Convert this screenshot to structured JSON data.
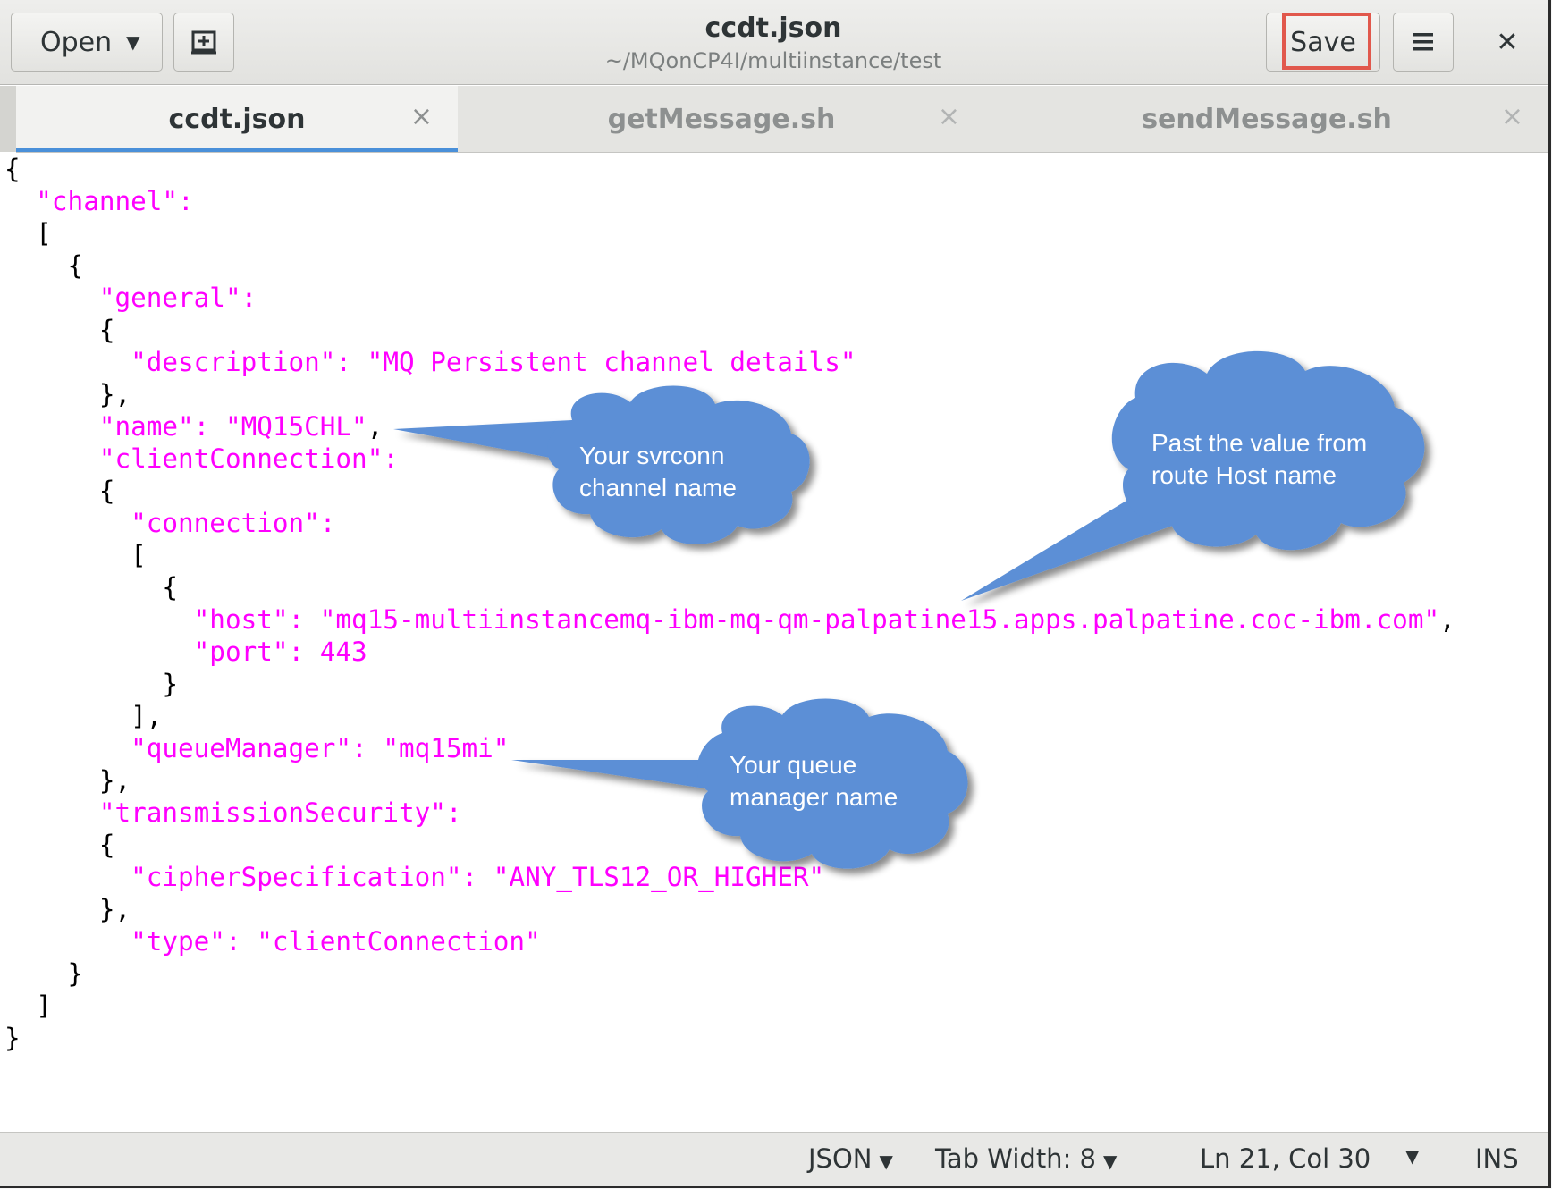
{
  "header": {
    "open_label": "Open",
    "title": "ccdt.json",
    "subtitle": "~/MQonCP4I/multiinstance/test",
    "save_label": "Save"
  },
  "tabs": [
    {
      "label": "ccdt.json",
      "active": true
    },
    {
      "label": "getMessage.sh",
      "active": false
    },
    {
      "label": "sendMessage.sh",
      "active": false
    }
  ],
  "code_lines": [
    [
      {
        "t": "{",
        "c": "p"
      }
    ],
    [
      {
        "t": "  ",
        "c": "p"
      },
      {
        "t": "\"channel\":",
        "c": "s"
      }
    ],
    [
      {
        "t": "  [",
        "c": "p"
      }
    ],
    [
      {
        "t": "    {",
        "c": "p"
      }
    ],
    [
      {
        "t": "      ",
        "c": "p"
      },
      {
        "t": "\"general\":",
        "c": "s"
      }
    ],
    [
      {
        "t": "      {",
        "c": "p"
      }
    ],
    [
      {
        "t": "        ",
        "c": "p"
      },
      {
        "t": "\"description\": \"MQ Persistent channel details\"",
        "c": "s"
      }
    ],
    [
      {
        "t": "      },",
        "c": "p"
      }
    ],
    [
      {
        "t": "      ",
        "c": "p"
      },
      {
        "t": "\"name\": \"MQ15CHL\"",
        "c": "s"
      },
      {
        "t": ",",
        "c": "p"
      }
    ],
    [
      {
        "t": "      ",
        "c": "p"
      },
      {
        "t": "\"clientConnection\":",
        "c": "s"
      }
    ],
    [
      {
        "t": "      {",
        "c": "p"
      }
    ],
    [
      {
        "t": "        ",
        "c": "p"
      },
      {
        "t": "\"connection\":",
        "c": "s"
      }
    ],
    [
      {
        "t": "        [",
        "c": "p"
      }
    ],
    [
      {
        "t": "          {",
        "c": "p"
      }
    ],
    [
      {
        "t": "            ",
        "c": "p"
      },
      {
        "t": "\"host\": \"mq15-multiinstancemq-ibm-mq-qm-palpatine15.apps.palpatine.coc-ibm.com\"",
        "c": "s"
      },
      {
        "t": ",",
        "c": "p"
      }
    ],
    [
      {
        "t": "            ",
        "c": "p"
      },
      {
        "t": "\"port\": 443",
        "c": "s"
      }
    ],
    [
      {
        "t": "          }",
        "c": "p"
      }
    ],
    [
      {
        "t": "        ],",
        "c": "p"
      }
    ],
    [
      {
        "t": "        ",
        "c": "p"
      },
      {
        "t": "\"queueManager\": \"mq15mi\"",
        "c": "s"
      }
    ],
    [
      {
        "t": "      },",
        "c": "p"
      }
    ],
    [
      {
        "t": "      ",
        "c": "p"
      },
      {
        "t": "\"transmissionSecurity\":",
        "c": "s"
      }
    ],
    [
      {
        "t": "      {",
        "c": "p"
      }
    ],
    [
      {
        "t": "        ",
        "c": "p"
      },
      {
        "t": "\"cipherSpecification\": \"ANY_TLS12_OR_HIGHER\"",
        "c": "s"
      }
    ],
    [
      {
        "t": "      },",
        "c": "p"
      }
    ],
    [
      {
        "t": "        ",
        "c": "p"
      },
      {
        "t": "\"type\": \"clientConnection\"",
        "c": "s"
      }
    ],
    [
      {
        "t": "    }",
        "c": "p"
      }
    ],
    [
      {
        "t": "  ]",
        "c": "p"
      }
    ],
    [
      {
        "t": "}",
        "c": "p"
      }
    ]
  ],
  "status": {
    "language": "JSON",
    "tab_width": "Tab Width: 8",
    "position": "Ln 21, Col 30",
    "mode": "INS"
  },
  "callouts": {
    "svrconn": [
      "Your svrconn",
      "channel name"
    ],
    "host": [
      "Past the value from",
      "route Host name"
    ],
    "queue_manager": [
      "Your queue",
      "manager  name"
    ]
  },
  "colors": {
    "json_string": "#ff00ff",
    "callout_fill": "#5b8fd6",
    "save_highlight": "#e1584c",
    "active_tab_underline": "#4a90d9"
  }
}
